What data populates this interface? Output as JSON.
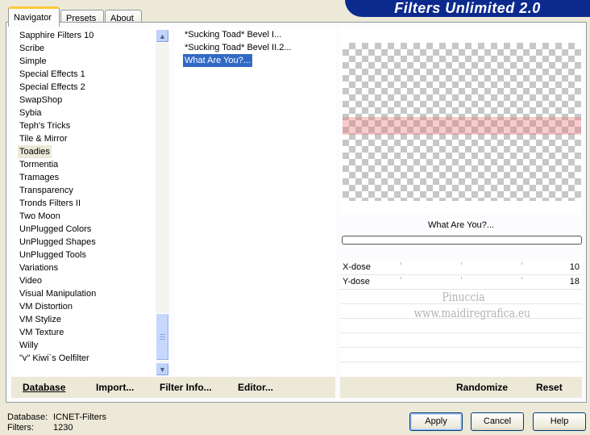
{
  "tabs": [
    {
      "label": "Navigator",
      "active": true
    },
    {
      "label": "Presets",
      "active": false
    },
    {
      "label": "About",
      "active": false
    }
  ],
  "app_title": "Filters Unlimited 2.0",
  "categories": [
    "Sapphire Filters 10",
    "Scribe",
    "Simple",
    "Special Effects 1",
    "Special Effects 2",
    "SwapShop",
    "Sybia",
    "Teph's Tricks",
    "Tile & Mirror",
    "Toadies",
    "Tormentia",
    "Tramages",
    "Transparency",
    "Tronds Filters II",
    "Two Moon",
    "UnPlugged Colors",
    "UnPlugged Shapes",
    "UnPlugged Tools",
    "Variations",
    "Video",
    "Visual Manipulation",
    "VM Distortion",
    "VM Stylize",
    "VM Texture",
    "Willy",
    "\"v\" Kiwi`s Oelfilter"
  ],
  "selected_category": "Toadies",
  "filters": [
    "*Sucking Toad*  Bevel I...",
    "*Sucking Toad*  Bevel II.2...",
    "What Are You?..."
  ],
  "selected_filter": "What Are You?...",
  "preview": {
    "filter_name": "What Are You?...",
    "progress": 0
  },
  "params": [
    {
      "label": "X-dose",
      "value": "10"
    },
    {
      "label": "Y-dose",
      "value": "18"
    }
  ],
  "watermark": {
    "line1": "Pinuccia",
    "line2": "www.maidiregrafica.eu"
  },
  "toolbar": {
    "database": "Database",
    "import": "Import...",
    "filter_info": "Filter Info...",
    "editor": "Editor...",
    "randomize": "Randomize",
    "reset": "Reset"
  },
  "status": {
    "database_label": "Database:",
    "database_value": "ICNET-Filters",
    "filters_label": "Filters:",
    "filters_value": "1230"
  },
  "buttons": {
    "apply": "Apply",
    "cancel": "Cancel",
    "help": "Help"
  },
  "colors": {
    "accent_blue": "#0c2a8e",
    "selection": "#316ac5",
    "dialog_bg": "#ece9d8",
    "preview_stripe": "#e87878"
  }
}
